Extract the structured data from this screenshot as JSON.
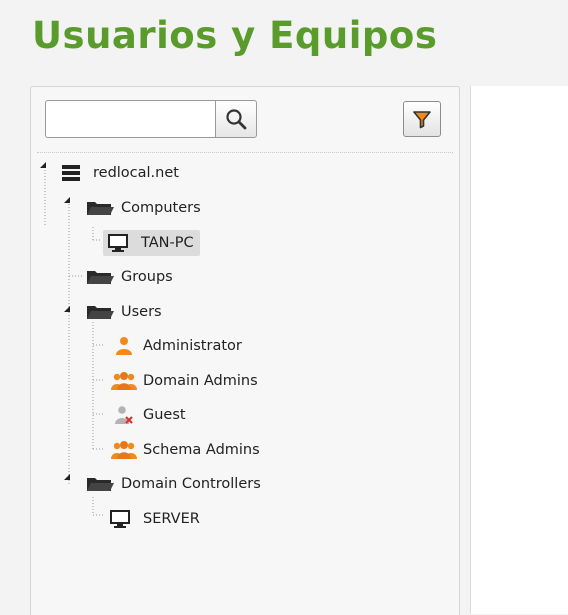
{
  "page": {
    "title": "Usuarios y Equipos"
  },
  "search": {
    "placeholder": "",
    "value": ""
  },
  "toolbar": {
    "search_icon": "magnifier-icon",
    "filter_icon": "funnel-icon",
    "accent": "#5a9c2b",
    "filter_color": "#f08a1c"
  },
  "tree": {
    "domain": "redlocal.net",
    "computers": {
      "label": "Computers",
      "items": [
        "TAN-PC"
      ]
    },
    "groups": {
      "label": "Groups"
    },
    "users": {
      "label": "Users",
      "items": [
        "Administrator",
        "Domain Admins",
        "Guest",
        "Schema Admins"
      ]
    },
    "domain_controllers": {
      "label": "Domain Controllers",
      "items": [
        "SERVER"
      ]
    }
  }
}
